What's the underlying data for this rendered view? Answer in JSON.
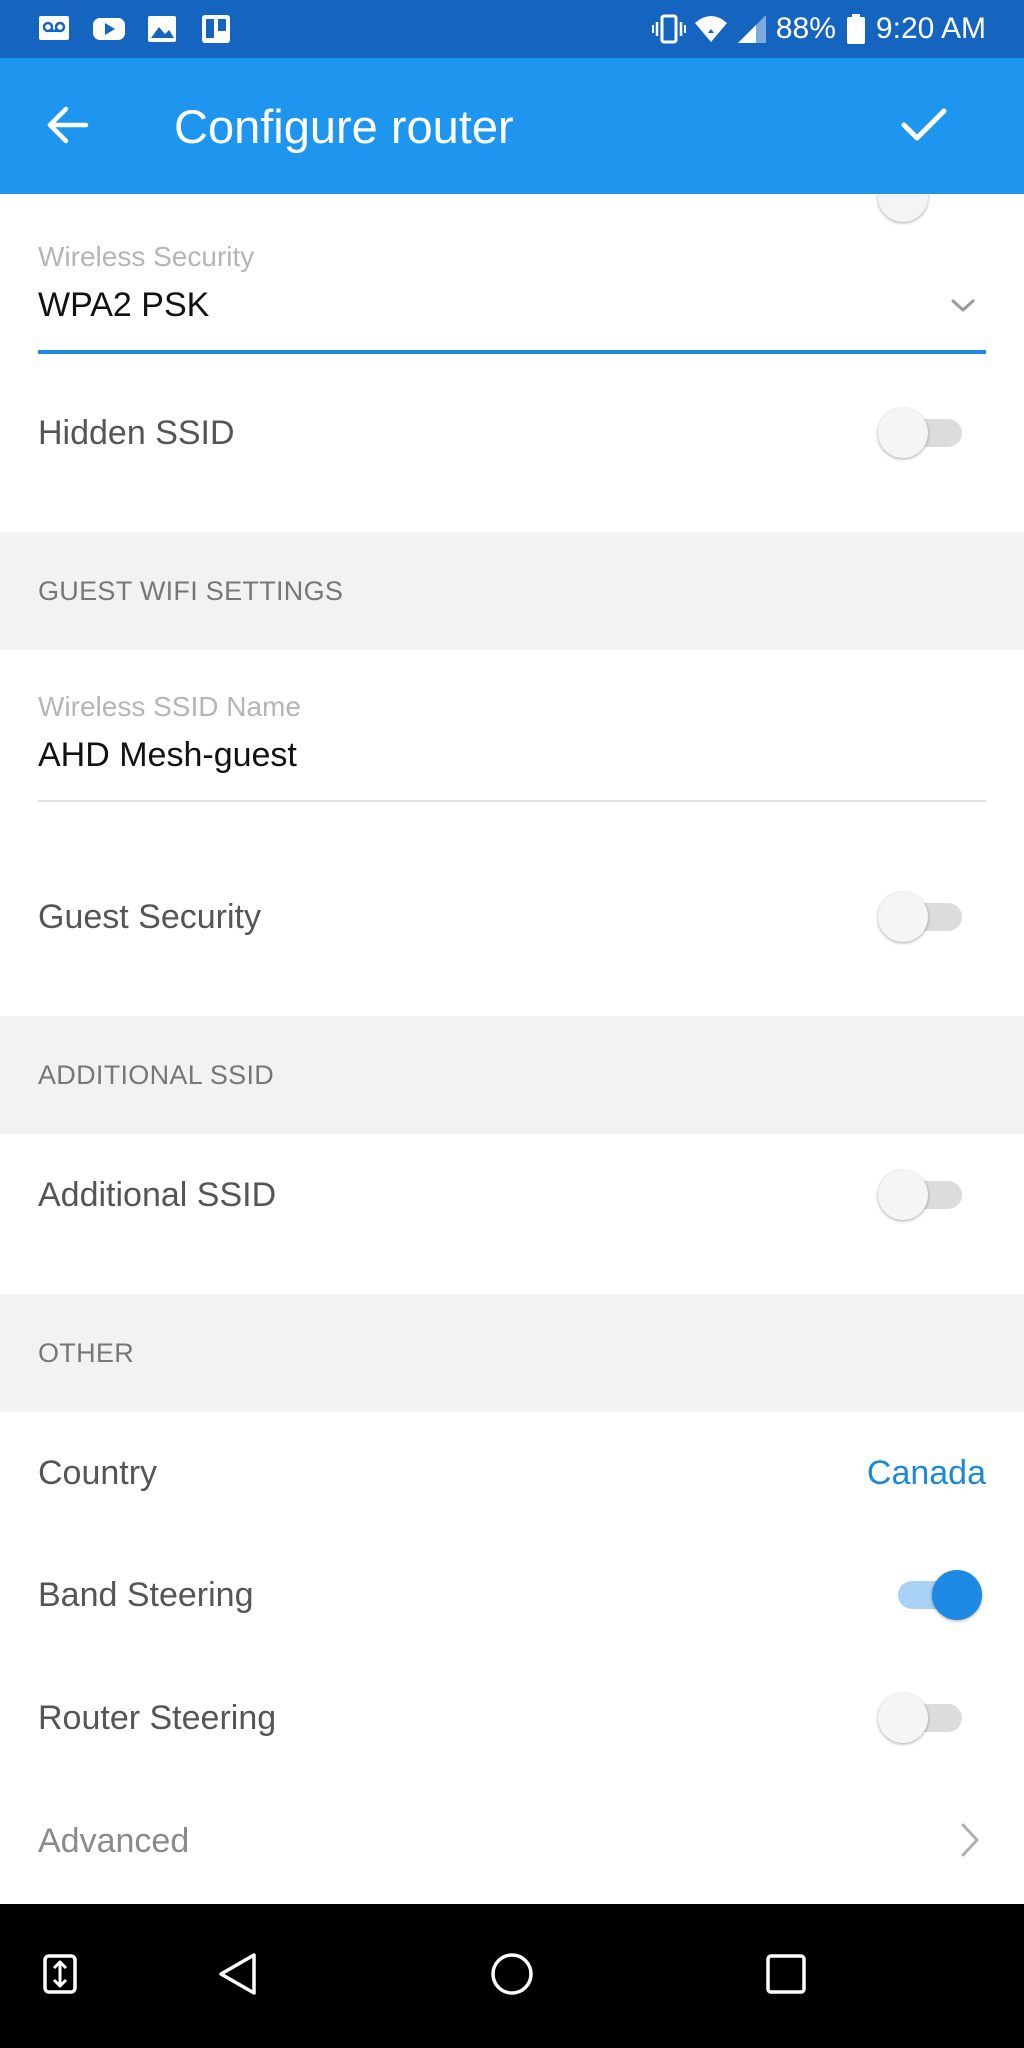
{
  "status_bar": {
    "icons_left": [
      "voicemail-icon",
      "youtube-icon",
      "gallery-icon",
      "trello-icon"
    ],
    "icons_right": [
      "vibrate-icon",
      "wifi-icon",
      "signal-icon",
      "battery-icon"
    ],
    "battery": "88%",
    "time": "9:20 AM"
  },
  "app_bar": {
    "title": "Configure router",
    "back_icon": "arrow-left-icon",
    "confirm_icon": "check-icon",
    "color": "#1e96f0"
  },
  "wireless": {
    "security_label": "Wireless Security",
    "security_value": "WPA2 PSK",
    "hidden_ssid_label": "Hidden SSID",
    "hidden_ssid_on": false
  },
  "guest": {
    "header": "GUEST WIFI SETTINGS",
    "ssid_name_label": "Wireless SSID Name",
    "ssid_name_value": "AHD Mesh-guest",
    "guest_security_label": "Guest Security",
    "guest_security_on": false
  },
  "additional": {
    "header": "ADDITIONAL SSID",
    "additional_ssid_label": "Additional SSID",
    "additional_ssid_on": false
  },
  "other": {
    "header": "OTHER",
    "country_label": "Country",
    "country_value": "Canada",
    "band_steering_label": "Band Steering",
    "band_steering_on": true,
    "router_steering_label": "Router Steering",
    "router_steering_on": false,
    "advanced_label": "Advanced"
  },
  "nav_bar": {
    "icons": [
      "swap-icon",
      "back-triangle-icon",
      "home-circle-icon",
      "recents-square-icon"
    ]
  },
  "colors": {
    "accent": "#1e88e5",
    "status_bar": "#1565c0",
    "section_bg": "#f2f2f2"
  }
}
